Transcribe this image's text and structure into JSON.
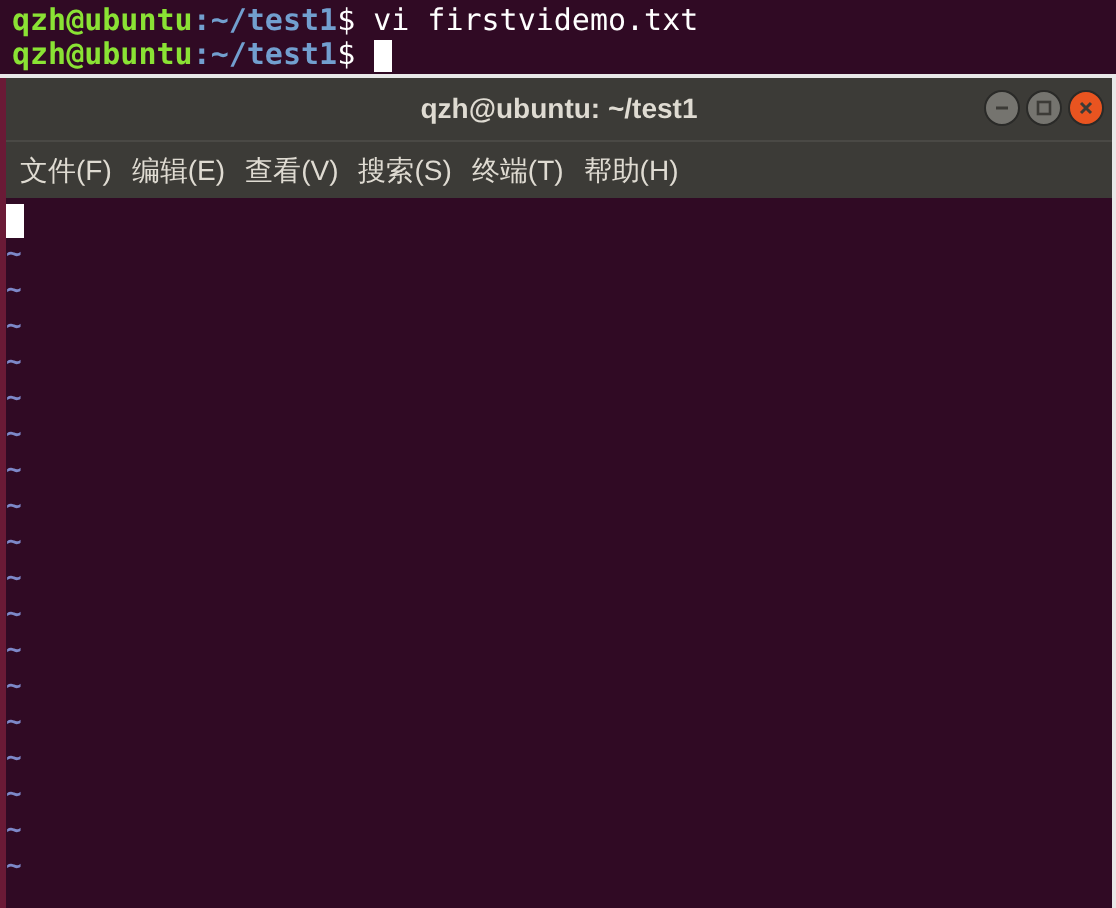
{
  "background_terminal": {
    "lines": [
      {
        "user_host": "qzh@ubuntu",
        "path": ":~/test1",
        "prompt": "$",
        "command": "vi firstvidemo.txt",
        "cursor": false
      },
      {
        "user_host": "qzh@ubuntu",
        "path": ":~/test1",
        "prompt": "$",
        "cursor": true
      }
    ]
  },
  "window": {
    "title": "qzh@ubuntu: ~/test1"
  },
  "menu": [
    "文件(F)",
    "编辑(E)",
    "查看(V)",
    "搜索(S)",
    "终端(T)",
    "帮助(H)"
  ],
  "editor": {
    "cursor": true,
    "empty_line_markers": [
      "~",
      "~",
      "~",
      "~",
      "~",
      "~",
      "~",
      "~",
      "~",
      "~",
      "~",
      "~",
      "~",
      "~",
      "~",
      "~",
      "~",
      "~"
    ]
  }
}
